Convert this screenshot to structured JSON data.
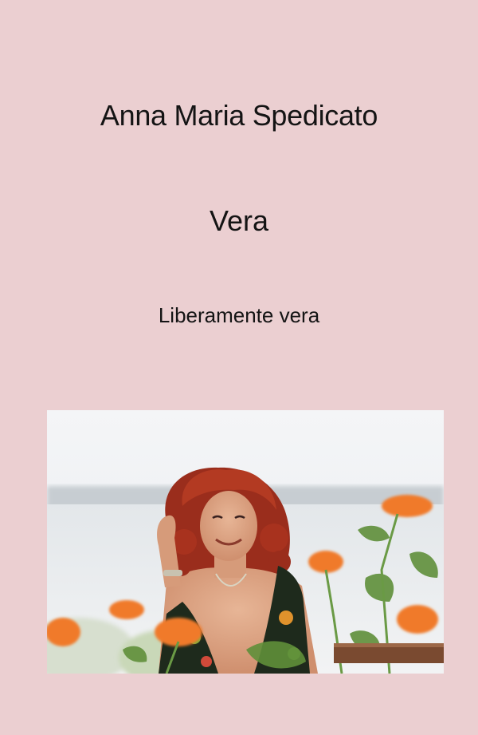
{
  "cover": {
    "author": "Anna Maria Spedicato",
    "title": "Vera",
    "subtitle": "Liberamente vera"
  },
  "colors": {
    "background": "#ebcfd1",
    "text": "#141414",
    "flower": "#f07a2a",
    "hair": "#a8321e"
  },
  "photo": {
    "subject": "woman-with-red-curly-hair-among-orange-flowers"
  }
}
